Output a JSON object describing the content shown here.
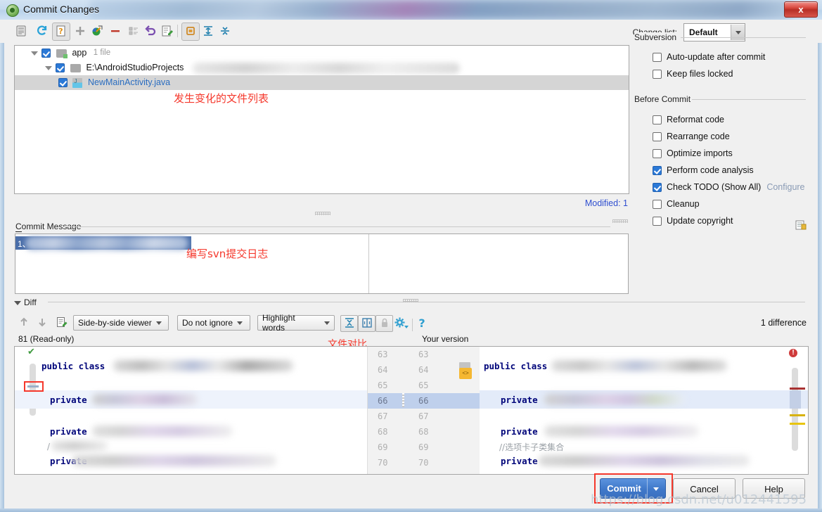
{
  "window": {
    "title": "Commit Changes",
    "close_label": "x",
    "app_icon": "android-icon"
  },
  "toolbar": {
    "buttons": [
      {
        "name": "show-diff-icon",
        "label": ""
      },
      {
        "name": "refresh-icon",
        "label": ""
      },
      {
        "name": "show-unversioned-icon",
        "label": ""
      },
      {
        "name": "add-icon",
        "label": ""
      },
      {
        "name": "move-to-changelist-icon",
        "label": ""
      },
      {
        "name": "delete-icon",
        "label": ""
      },
      {
        "name": "list-icon",
        "label": ""
      },
      {
        "name": "revert-icon",
        "label": ""
      },
      {
        "name": "edit-source-icon",
        "label": ""
      },
      {
        "name": "group-by-directory-icon",
        "label": ""
      },
      {
        "name": "expand-all-icon",
        "label": ""
      },
      {
        "name": "collapse-all-icon",
        "label": ""
      }
    ],
    "change_list_label": "Change list:",
    "change_list_value": "Default"
  },
  "file_tree": {
    "rows": [
      {
        "label": "app",
        "count": "1 file",
        "checked": true,
        "type": "module",
        "selected": false
      },
      {
        "label": "E:\\AndroidStudioProjects",
        "count": "",
        "checked": true,
        "type": "folder",
        "selected": false
      },
      {
        "label": "NewMainActivity.java",
        "count": "",
        "checked": true,
        "type": "java",
        "selected": true
      }
    ],
    "annotation": "发生变化的文件列表",
    "status": "Modified: 1"
  },
  "right_panel": {
    "subversion_title": "Subversion",
    "subversion_options": [
      {
        "label": "Auto-update after commit",
        "checked": false
      },
      {
        "label": "Keep files locked",
        "checked": false
      }
    ],
    "before_commit_title": "Before Commit",
    "before_commit_options": [
      {
        "label": "Reformat code",
        "checked": false
      },
      {
        "label": "Rearrange code",
        "checked": false
      },
      {
        "label": "Optimize imports",
        "checked": false
      },
      {
        "label": "Perform code analysis",
        "checked": true
      },
      {
        "label": "Check TODO (Show All)",
        "checked": true,
        "extra": "Configure"
      },
      {
        "label": "Cleanup",
        "checked": false
      },
      {
        "label": "Update copyright",
        "checked": false
      }
    ]
  },
  "commit_message": {
    "label": "Commit Message",
    "line_number": "1、",
    "annotation": "编写svn提交日志"
  },
  "diff": {
    "section_label": "Diff",
    "viewer_mode": "Side-by-side viewer",
    "ignore_mode": "Do not ignore",
    "highlight_mode": "Highlight words",
    "difference_count": "1 difference",
    "left_title": "81 (Read-only)",
    "right_title": "Your version",
    "annotation": "文件对比",
    "line_numbers": [
      "63",
      "64",
      "65",
      "66",
      "67",
      "68",
      "69",
      "70"
    ],
    "left_code": [
      {
        "kw": "public class",
        "indent": 0
      },
      {
        "kw": "private",
        "indent": 1
      },
      {
        "kw": "private",
        "indent": 1
      },
      {
        "kw": "private",
        "indent": 1
      }
    ],
    "right_code": [
      {
        "kw": "public class",
        "indent": 0
      },
      {
        "kw": "private",
        "indent": 1
      },
      {
        "kw": "private",
        "indent": 1
      },
      {
        "kw": "private",
        "indent": 1
      }
    ],
    "right_comment": "//选项卡子类集合"
  },
  "footer": {
    "commit_label": "Commit",
    "cancel_label": "Cancel",
    "help_label": "Help"
  },
  "watermark": "https://blog.csdn.net/u012441595"
}
